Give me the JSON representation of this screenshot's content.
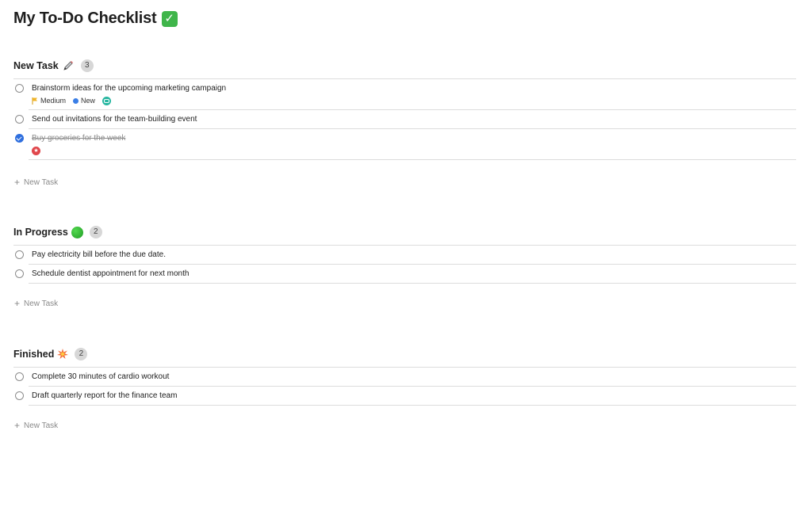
{
  "page": {
    "title": "My To-Do Checklist"
  },
  "sections": [
    {
      "title": "New Task",
      "icon": "pencil-icon",
      "count": "3",
      "new_task_label": "New Task",
      "tasks": [
        {
          "text": "Brainstorm ideas for the upcoming marketing campaign",
          "done": false,
          "priority": "Medium",
          "status": "New"
        },
        {
          "text": "Send out invitations for the team-building event",
          "done": false
        },
        {
          "text": "Buy groceries for the week",
          "done": true
        }
      ]
    },
    {
      "title": "In Progress",
      "icon": "green-circle-icon",
      "count": "2",
      "new_task_label": "New Task",
      "tasks": [
        {
          "text": "Pay electricity bill before the due date.",
          "done": false
        },
        {
          "text": "Schedule dentist appointment for next month",
          "done": false
        }
      ]
    },
    {
      "title": "Finished",
      "icon": "burst-icon",
      "count": "2",
      "new_task_label": "New Task",
      "tasks": [
        {
          "text": "Complete 30 minutes of cardio workout",
          "done": false
        },
        {
          "text": "Draft quarterly report for the finance team",
          "done": false
        }
      ]
    }
  ],
  "colors": {
    "accent": "#2f6fde",
    "priority_flag": "#f0b429",
    "status_dot": "#3a7ee6",
    "tag": "#27b6a0",
    "star": "#e0474c"
  }
}
